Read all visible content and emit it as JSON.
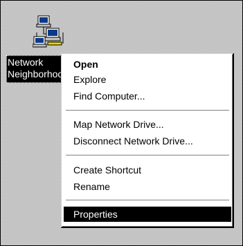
{
  "desktop": {
    "icon": {
      "name": "network-neighborhood-icon",
      "label": "Network\nNeighborhood"
    }
  },
  "context_menu": {
    "items": [
      {
        "label": "Open",
        "style": "default"
      },
      {
        "label": "Explore"
      },
      {
        "label": "Find Computer..."
      },
      {
        "label": "Map Network Drive..."
      },
      {
        "label": "Disconnect Network Drive..."
      },
      {
        "label": "Create Shortcut"
      },
      {
        "label": "Rename"
      },
      {
        "label": "Properties",
        "state": "highlighted"
      }
    ]
  }
}
